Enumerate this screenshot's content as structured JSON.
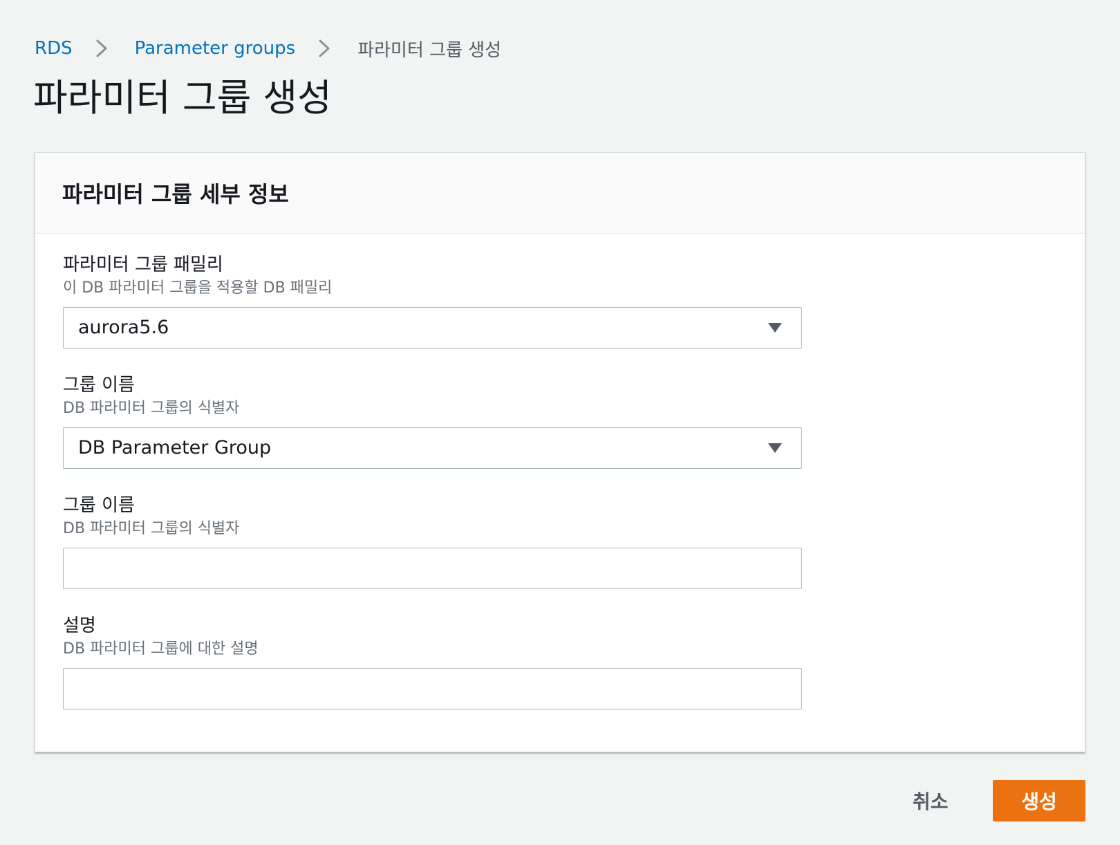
{
  "breadcrumb": {
    "items": [
      {
        "label": "RDS"
      },
      {
        "label": "Parameter groups"
      },
      {
        "label": "파라미터 그룹 생성"
      }
    ]
  },
  "page": {
    "title": "파라미터 그룹 생성"
  },
  "panel": {
    "title": "파라미터 그룹 세부 정보",
    "fields": [
      {
        "label": "파라미터 그룹 패밀리",
        "description": "이 DB 파라미터 그룹을 적용할 DB 패밀리",
        "type": "select",
        "value": "aurora5.6"
      },
      {
        "label": "그룹 이름",
        "description": "DB 파라미터 그룹의 식별자",
        "type": "select",
        "value": "DB Parameter Group"
      },
      {
        "label": "그룹 이름",
        "description": "DB 파라미터 그룹의 식별자",
        "type": "text",
        "value": ""
      },
      {
        "label": "설명",
        "description": "DB 파라미터 그룹에 대한 설명",
        "type": "text",
        "value": ""
      }
    ]
  },
  "actions": {
    "cancel_label": "취소",
    "create_label": "생성"
  },
  "icons": {
    "breadcrumb_separator": "chevron-right-icon",
    "select_caret": "caret-down-icon"
  },
  "colors": {
    "link": "#0073bb",
    "primary_button": "#ec7211",
    "background": "#f2f3f3"
  }
}
